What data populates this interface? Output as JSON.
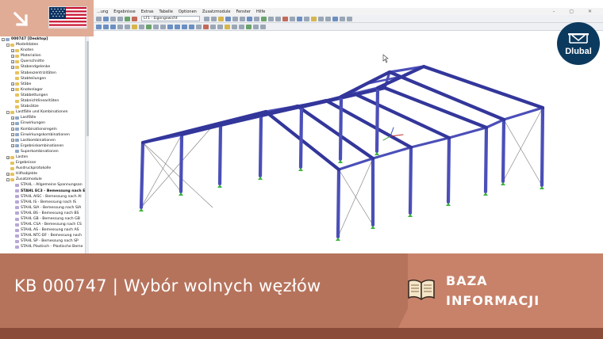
{
  "menu": [
    "...ung",
    "Ergebnisse",
    "Extras",
    "Tabelle",
    "Optionen",
    "Zusatzmodule",
    "Fenster",
    "Hilfe"
  ],
  "toolbar": {
    "loadcase": "LF1 - Eigengewicht"
  },
  "navigator": {
    "items": [
      {
        "label": "000747 [Desktop]",
        "level": 0,
        "kind": "leaf",
        "bold": true,
        "exp": "-"
      },
      {
        "label": "Modelldaten",
        "level": 1,
        "kind": "folder",
        "exp": "-"
      },
      {
        "label": "Knoten",
        "level": 2,
        "kind": "folder",
        "exp": "+"
      },
      {
        "label": "Materialien",
        "level": 2,
        "kind": "folder",
        "exp": "+"
      },
      {
        "label": "Querschnitte",
        "level": 2,
        "kind": "folder",
        "exp": "+"
      },
      {
        "label": "Stabendgelenke",
        "level": 2,
        "kind": "folder",
        "exp": "+"
      },
      {
        "label": "Stabexzentrizitäten",
        "level": 2,
        "kind": "folder",
        "exp": ""
      },
      {
        "label": "Stabteilungen",
        "level": 2,
        "kind": "folder",
        "exp": ""
      },
      {
        "label": "Stäbe",
        "level": 2,
        "kind": "folder",
        "exp": "+"
      },
      {
        "label": "Knotenlager",
        "level": 2,
        "kind": "folder",
        "exp": "+"
      },
      {
        "label": "Stabbettungen",
        "level": 2,
        "kind": "folder",
        "exp": ""
      },
      {
        "label": "Stabnichtlinearitäten",
        "level": 2,
        "kind": "folder",
        "exp": ""
      },
      {
        "label": "Stabsätze",
        "level": 2,
        "kind": "folder",
        "exp": ""
      },
      {
        "label": "Lastfälle und Kombinationen",
        "level": 1,
        "kind": "folder",
        "exp": "-"
      },
      {
        "label": "Lastfälle",
        "level": 2,
        "kind": "leaf",
        "exp": "+"
      },
      {
        "label": "Einwirkungen",
        "level": 2,
        "kind": "leaf",
        "exp": "+"
      },
      {
        "label": "Kombinationsregeln",
        "level": 2,
        "kind": "leaf",
        "exp": "+"
      },
      {
        "label": "Einwirkungskombinationen",
        "level": 2,
        "kind": "leaf",
        "exp": "+"
      },
      {
        "label": "Lastkombinationen",
        "level": 2,
        "kind": "leaf",
        "exp": "+"
      },
      {
        "label": "Ergebniskombinationen",
        "level": 2,
        "kind": "leaf",
        "exp": "+"
      },
      {
        "label": "Superkombinationen",
        "level": 2,
        "kind": "leaf",
        "exp": ""
      },
      {
        "label": "Lasten",
        "level": 1,
        "kind": "folder",
        "exp": "+"
      },
      {
        "label": "Ergebnisse",
        "level": 1,
        "kind": "folder",
        "exp": ""
      },
      {
        "label": "Ausdruckprotokolle",
        "level": 1,
        "kind": "folder",
        "exp": ""
      },
      {
        "label": "Hilfsobjekte",
        "level": 1,
        "kind": "folder",
        "exp": "+"
      },
      {
        "label": "Zusatzmodule",
        "level": 1,
        "kind": "folder",
        "exp": "-"
      },
      {
        "label": "STAHL - Allgemeine Spannungsan",
        "level": 2,
        "kind": "res",
        "exp": ""
      },
      {
        "label": "STAHL EC3 - Bemessung nach Eu",
        "level": 2,
        "kind": "res",
        "exp": "",
        "bold": true
      },
      {
        "label": "STAHL AISC - Bemessung nach AI",
        "level": 2,
        "kind": "res",
        "exp": ""
      },
      {
        "label": "STAHL IS - Bemessung nach IS",
        "level": 2,
        "kind": "res",
        "exp": ""
      },
      {
        "label": "STAHL SIA - Bemessung nach SIA",
        "level": 2,
        "kind": "res",
        "exp": ""
      },
      {
        "label": "STAHL BS - Bemessung nach BS",
        "level": 2,
        "kind": "res",
        "exp": ""
      },
      {
        "label": "STAHL GB - Bemessung nach GB",
        "level": 2,
        "kind": "res",
        "exp": ""
      },
      {
        "label": "STAHL CSA - Bemessung nach CS",
        "level": 2,
        "kind": "res",
        "exp": ""
      },
      {
        "label": "STAHL AS - Bemessung nach AS",
        "level": 2,
        "kind": "res",
        "exp": ""
      },
      {
        "label": "STAHL NTC-DF - Bemessung nach",
        "level": 2,
        "kind": "res",
        "exp": ""
      },
      {
        "label": "STAHL SP - Bemessung nach SP",
        "level": 2,
        "kind": "res",
        "exp": ""
      },
      {
        "label": "STAHL Plastisch - Plastische Beme",
        "level": 2,
        "kind": "res",
        "exp": ""
      }
    ]
  },
  "logo": {
    "text": "Dlubal"
  },
  "banner": {
    "title": "KB 000747 | Wybór wolnych węzłów",
    "category_line1": "BAZA",
    "category_line2": "INFORMACJI"
  },
  "colors": {
    "member": "#4b4fb8",
    "member_dark": "#33369a",
    "banner": "#b6735c",
    "banner_light": "#c8826a"
  }
}
